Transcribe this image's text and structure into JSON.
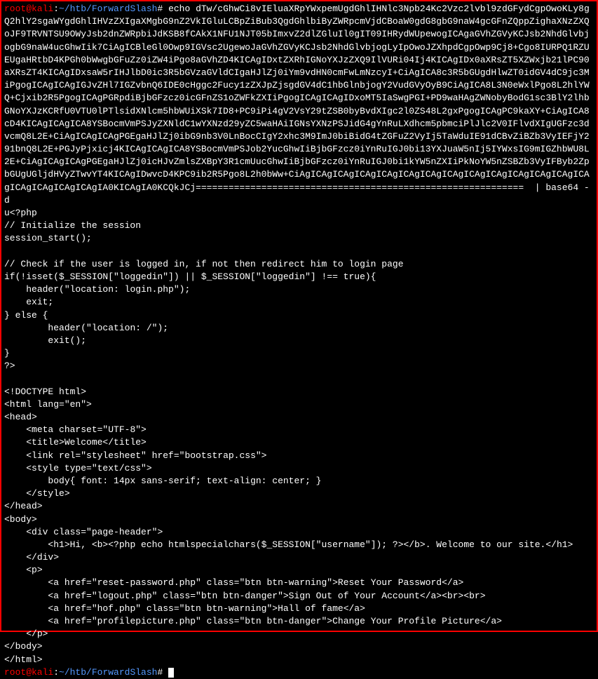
{
  "prompt1": {
    "user": "root@kali",
    "sep1": ":",
    "path": "~/htb/ForwardSlash",
    "suffix": "# "
  },
  "prompt2": {
    "user": "root@kali",
    "sep1": ":",
    "path": "~/htb/ForwardSlash",
    "suffix": "# "
  },
  "command": "echo dTw/cGhwCi8vIEluaXRpYWxpemUgdGhlIHNlc3Npb24Kc2Vzc2lvbl9zdGFydCgpOwoKLy8gQ2hlY2sgaWYgdGhlIHVzZXIgaXMgbG9nZ2VkIGluLCBpZiBub3QgdGhlbiByZWRpcmVjdCBoaW0gdG8gbG9naW4gcGFnZQppZighaXNzZXQoJF9TRVNTSU9OWyJsb2dnZWRpbiJdKSB8fCAkX1NFU1NJT05bImxvZ2dlZGluIl0gIT09IHRydWUpewogICAgaGVhZGVyKCJsb2NhdGlvbjogbG9naW4ucGhwIik7CiAgICBleGl0Owp9IGVsc2UgewoJaGVhZGVyKCJsb2NhdGlvbjogLyIpOwoJZXhpdCgpOwp9Cj8+Cgo8IURPQ1RZUEUgaHRtbD4KPGh0bWwgbGFuZz0iZW4iPgo8aGVhZD4KICAgIDxtZXRhIGNoYXJzZXQ9IlVURi04Ij4KICAgIDx0aXRsZT5XZWxjb21lPC90aXRsZT4KICAgIDxsaW5rIHJlbD0ic3R5bGVzaGVldCIgaHJlZj0iYm9vdHN0cmFwLmNzcyI+CiAgICA8c3R5bGUgdHlwZT0idGV4dC9jc3MiPgogICAgICAgIGJvZHl7IGZvbnQ6IDE0cHggc2Fucy1zZXJpZjsgdGV4dC1hbGlnbjogY2VudGVyOyB9CiAgICA8L3N0eWxlPgo8L2hlYWQ+Cjxib2R5PgogICAgPGRpdiBjbGFzcz0icGFnZS1oZWFkZXIiPgogICAgICAgIDxoMT5IaSwgPGI+PD9waHAgZWNobyBodG1sc3BlY2lhbGNoYXJzKCRfU0VTU0lPTlsidXNlcm5hbWUiXSk7ID8+PC9iPi4gV2VsY29tZSB0byBvdXIgc2l0ZS48L2gxPgogICAgPC9kaXY+CiAgICA8cD4KICAgICAgICA8YSBocmVmPSJyZXNldC1wYXNzd29yZC5waHAiIGNsYXNzPSJidG4gYnRuLXdhcm5pbmciPlJlc2V0IFlvdXIgUGFzc3dvcmQ8L2E+CiAgICAgICAgPGEgaHJlZj0ibG9nb3V0LnBocCIgY2xhc3M9ImJ0biBidG4tZGFuZ2VyIj5TaWduIE91dCBvZiBZb3VyIEFjY291bnQ8L2E+PGJyPjxicj4KICAgICAgICA8YSBocmVmPSJob2YucGhwIiBjbGFzcz0iYnRuIGJ0bi13YXJuaW5nIj5IYWxsIG9mIGZhbWU8L2E+CiAgICAgICAgPGEgaHJlZj0icHJvZmlsZXBpY3R1cmUucGhwIiBjbGFzcz0iYnRuIGJ0bi1kYW5nZXIiPkNoYW5nZSBZb3VyIFByb2ZpbGUgUGljdHVyZTwvYT4KICAgIDwvcD4KPC9ib2R5Pgo8L2h0bWw+CiAgICAgICAgICAgICAgICAgICAgICAgICAgICAgICAgICAgICAgICAgICAgICAgICAgICAgIA0KICAgIA0KCQkJCj============================================================  | base64 -d",
  "output": "u<?php\n// Initialize the session\nsession_start();\n\n// Check if the user is logged in, if not then redirect him to login page\nif(!isset($_SESSION[\"loggedin\"]) || $_SESSION[\"loggedin\"] !== true){\n    header(\"location: login.php\");\n    exit;\n} else {\n\theader(\"location: /\");\n\texit();\n}\n?>\n\n<!DOCTYPE html>\n<html lang=\"en\">\n<head>\n    <meta charset=\"UTF-8\">\n    <title>Welcome</title>\n    <link rel=\"stylesheet\" href=\"bootstrap.css\">\n    <style type=\"text/css\">\n        body{ font: 14px sans-serif; text-align: center; }\n    </style>\n</head>\n<body>\n    <div class=\"page-header\">\n        <h1>Hi, <b><?php echo htmlspecialchars($_SESSION[\"username\"]); ?></b>. Welcome to our site.</h1>\n    </div>\n    <p>\n        <a href=\"reset-password.php\" class=\"btn btn-warning\">Reset Your Password</a>\n        <a href=\"logout.php\" class=\"btn btn-danger\">Sign Out of Your Account</a><br><br>\n        <a href=\"hof.php\" class=\"btn btn-warning\">Hall of fame</a>\n        <a href=\"profilepicture.php\" class=\"btn btn-danger\">Change Your Profile Picture</a>\n    </p>\n</body>\n</html>"
}
